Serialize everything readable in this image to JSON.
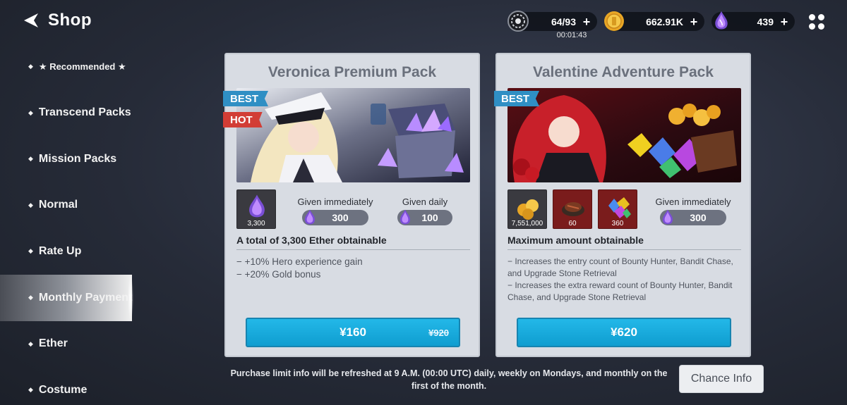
{
  "header": {
    "title": "Shop",
    "stamina": {
      "value": "64/93",
      "timer": "00:01:43"
    },
    "gold": {
      "value": "662.91K"
    },
    "ether": {
      "value": "439"
    },
    "plus_label": "+"
  },
  "sidebar": {
    "items": [
      {
        "label": "★ Recommended ★"
      },
      {
        "label": "Transcend Packs"
      },
      {
        "label": "Mission Packs"
      },
      {
        "label": "Normal"
      },
      {
        "label": "Rate Up"
      },
      {
        "label": "Monthly Payment",
        "active": true
      },
      {
        "label": "Ether"
      },
      {
        "label": "Costume"
      }
    ]
  },
  "packs": [
    {
      "title": "Veronica Premium Pack",
      "tags": [
        "BEST",
        "HOT"
      ],
      "items": [
        {
          "icon": "ether-crystal-icon",
          "qty": "3,300"
        }
      ],
      "given_immediately": {
        "label": "Given immediately",
        "value": "300"
      },
      "given_daily": {
        "label": "Given daily",
        "value": "100"
      },
      "obtain_text": "A total of 3,300 Ether obtainable",
      "desc_lines": [
        "− +10% Hero experience gain",
        "− +20% Gold bonus"
      ],
      "price": "¥160",
      "old_price": "¥920"
    },
    {
      "title": "Valentine Adventure Pack",
      "tags": [
        "BEST"
      ],
      "items": [
        {
          "icon": "gold-coins-icon",
          "qty": "7,551,000"
        },
        {
          "icon": "steak-icon",
          "qty": "60"
        },
        {
          "icon": "gems-icon",
          "qty": "360"
        }
      ],
      "given_immediately": {
        "label": "Given immediately",
        "value": "300"
      },
      "obtain_text": "Maximum amount obtainable",
      "desc_lines": [
        "− Increases the entry count of Bounty Hunter, Bandit Chase, and Upgrade Stone Retrieval",
        "− Increases the extra reward count of Bounty Hunter, Bandit Chase, and Upgrade Stone Retrieval"
      ],
      "price": "¥620"
    }
  ],
  "footer": {
    "note": "Purchase limit info will be refreshed at 9 A.M. (00:00 UTC) daily, weekly on Mondays, and monthly on the first of the month.",
    "chance_label": "Chance Info"
  },
  "colors": {
    "buy_button": "#1aaade",
    "best_tag": "#2f8fc4",
    "hot_tag": "#d23d35",
    "card_bg": "#d8dce3"
  }
}
